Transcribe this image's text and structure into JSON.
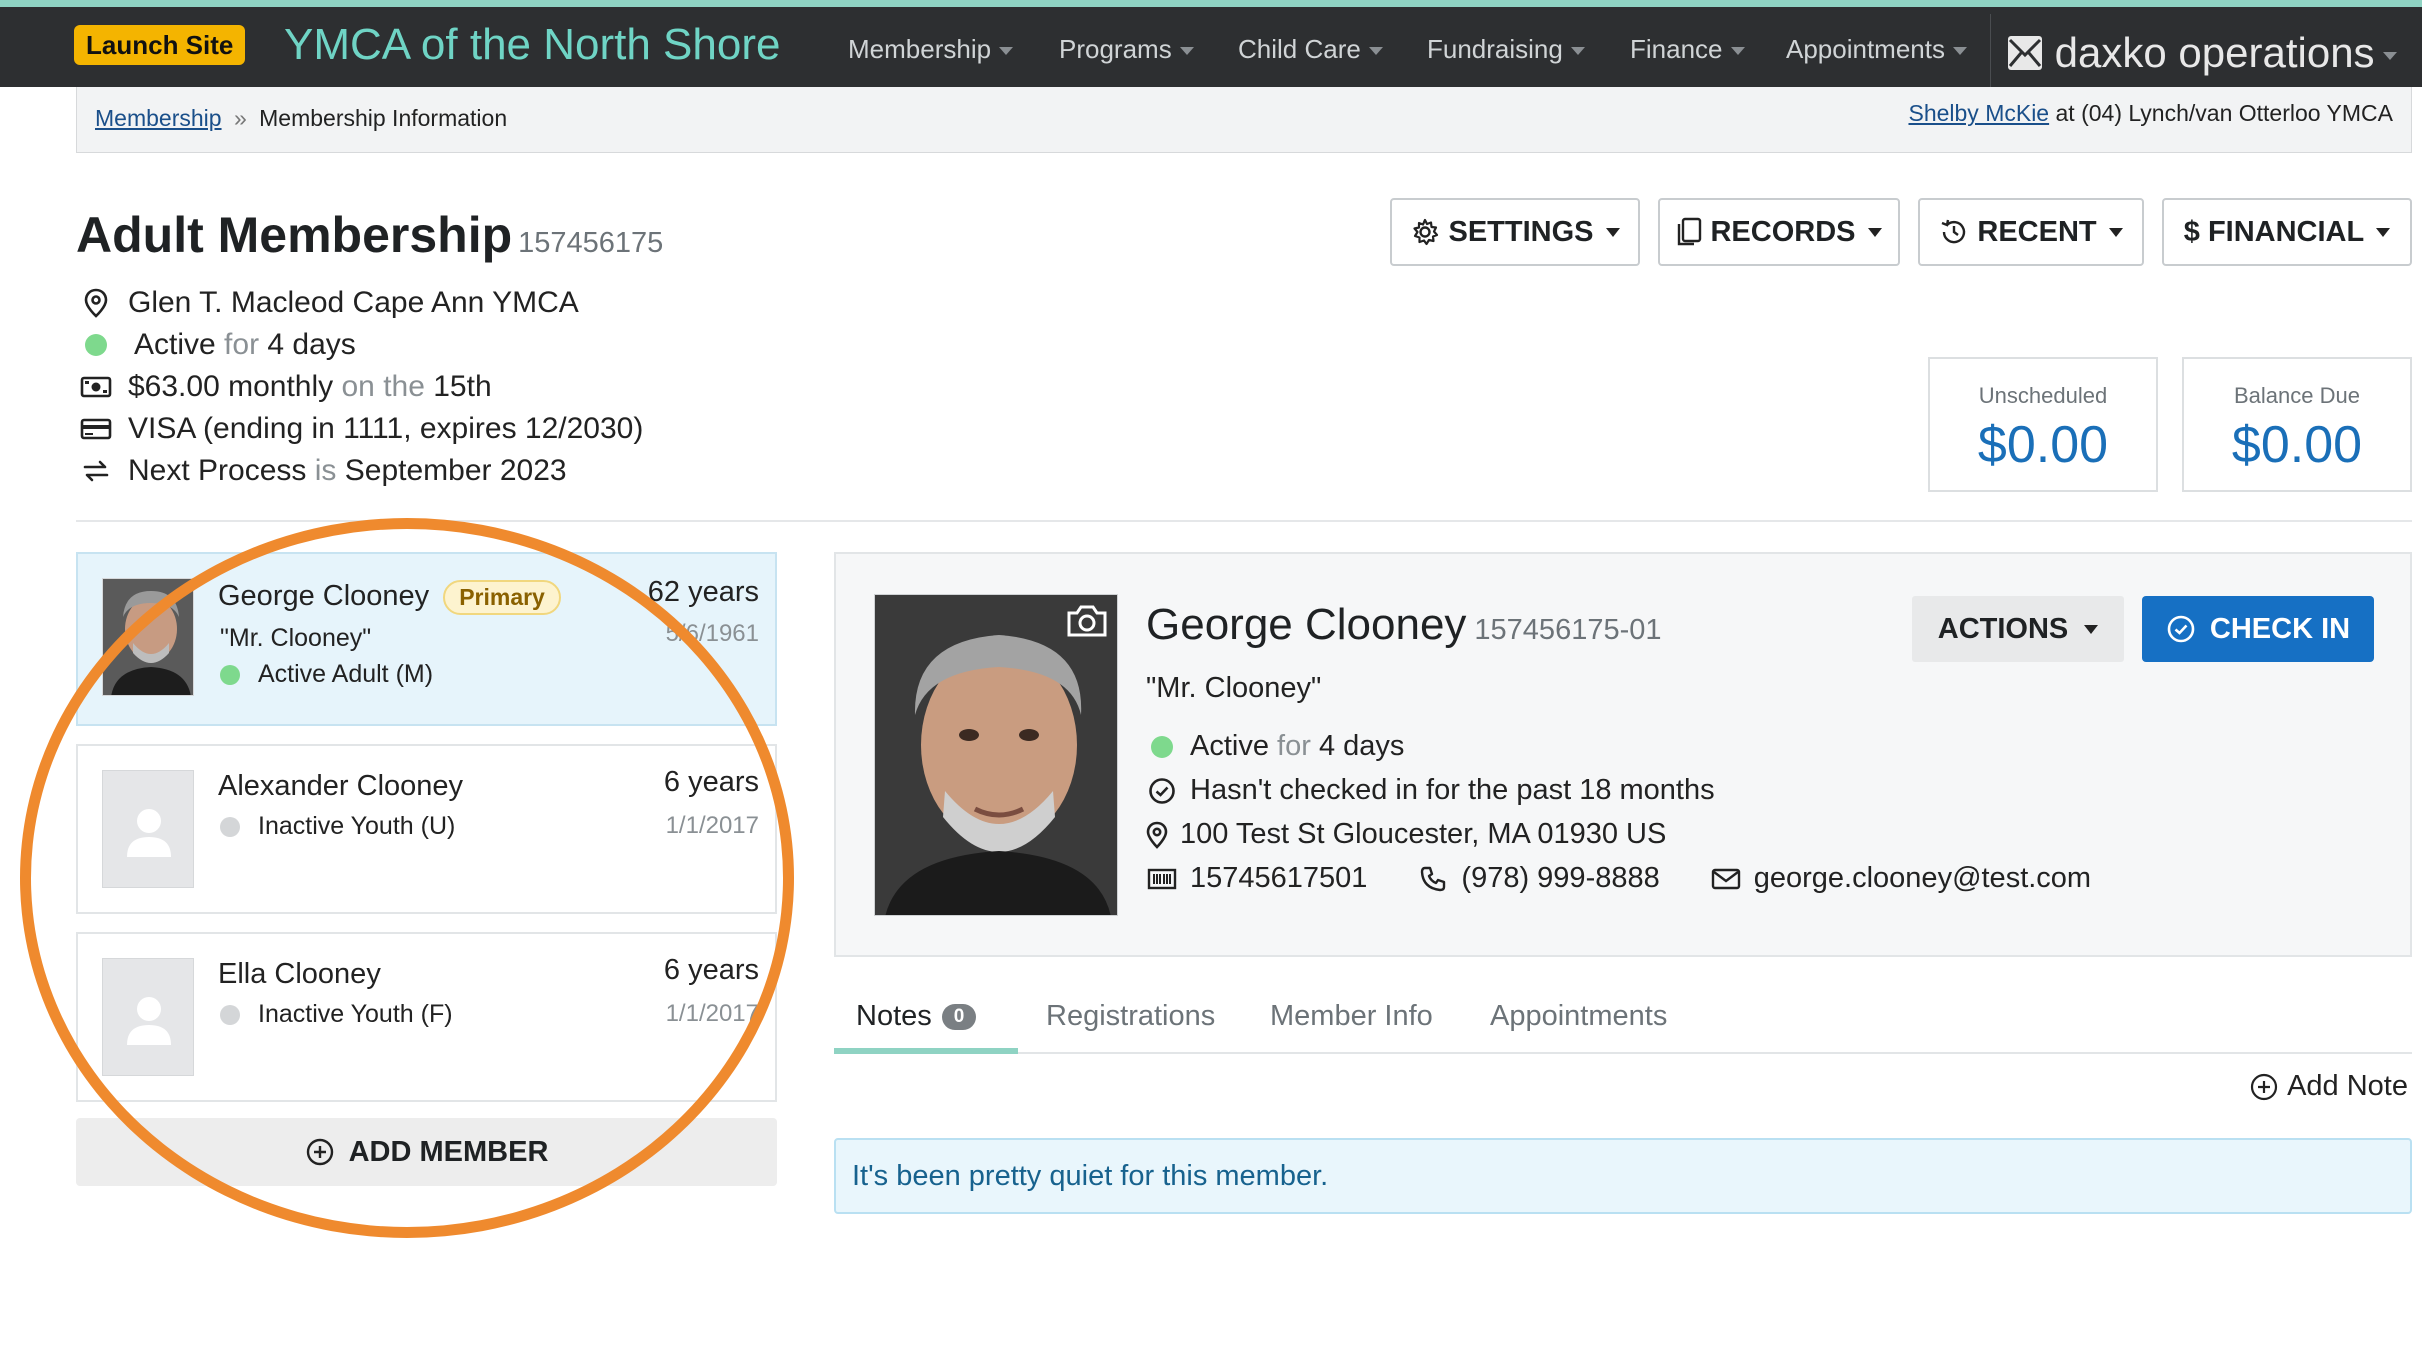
{
  "nav": {
    "launch_label": "Launch Site",
    "brand": "YMCA of the North Shore",
    "items": [
      "Membership",
      "Programs",
      "Child Care",
      "Fundraising",
      "Finance",
      "Appointments"
    ],
    "logo_text": "daxko operations"
  },
  "breadcrumb": {
    "link": "Membership",
    "separator": "»",
    "current": "Membership Information"
  },
  "user": {
    "name": "Shelby McKie",
    "at": "at",
    "location": "(04) Lynch/van Otterloo YMCA"
  },
  "membership": {
    "title": "Adult Membership",
    "number": "157456175",
    "branch": "Glen T. Macleod Cape Ann YMCA",
    "status": "Active",
    "status_for": "for",
    "status_duration": "4 days",
    "amount": "$63.00 monthly",
    "amount_on": "on the",
    "amount_day": "15th",
    "card": "VISA (ending in 1111, expires 12/2030)",
    "next_label": "Next Process",
    "next_is": "is",
    "next_value": "September 2023"
  },
  "header_buttons": {
    "settings": "SETTINGS",
    "records": "RECORDS",
    "recent": "RECENT",
    "financial": "FINANCIAL"
  },
  "balances": {
    "unscheduled_label": "Unscheduled",
    "unscheduled_value": "$0.00",
    "balance_label": "Balance Due",
    "balance_value": "$0.00"
  },
  "members": [
    {
      "name": "George Clooney",
      "badge": "Primary",
      "nickname": "\"Mr. Clooney\"",
      "status": "Active Adult (M)",
      "age": "62 years",
      "dob": "5/6/1961"
    },
    {
      "name": "Alexander Clooney",
      "status": "Inactive Youth (U)",
      "age": "6 years",
      "dob": "1/1/2017"
    },
    {
      "name": "Ella Clooney",
      "status": "Inactive Youth (F)",
      "age": "6 years",
      "dob": "1/1/2017"
    }
  ],
  "add_member_label": "ADD MEMBER",
  "detail": {
    "name": "George Clooney",
    "number": "157456175-01",
    "nickname": "\"Mr. Clooney\"",
    "status": "Active",
    "status_for": "for",
    "status_duration": "4 days",
    "checkin_note": "Hasn't checked in for the past 18 months",
    "address": "100 Test St Gloucester, MA 01930 US",
    "barcode": "15745617501",
    "phone": "(978) 999-8888",
    "email": "george.clooney@test.com",
    "actions_label": "ACTIONS",
    "checkin_label": "CHECK IN"
  },
  "tabs": {
    "notes": "Notes",
    "notes_count": "0",
    "registrations": "Registrations",
    "member_info": "Member Info",
    "appointments": "Appointments"
  },
  "add_note_label": "Add Note",
  "empty_message": "It's been pretty quiet for this member.",
  "colors": {
    "nav_bg": "#2d2f31",
    "brand": "#6fd4c5",
    "launch": "#f4b400",
    "accent_blue": "#1670c4",
    "active_dot": "#7ed98d",
    "inactive_dot": "#d4d6d8",
    "highlight_circle": "#ef8a2e"
  }
}
